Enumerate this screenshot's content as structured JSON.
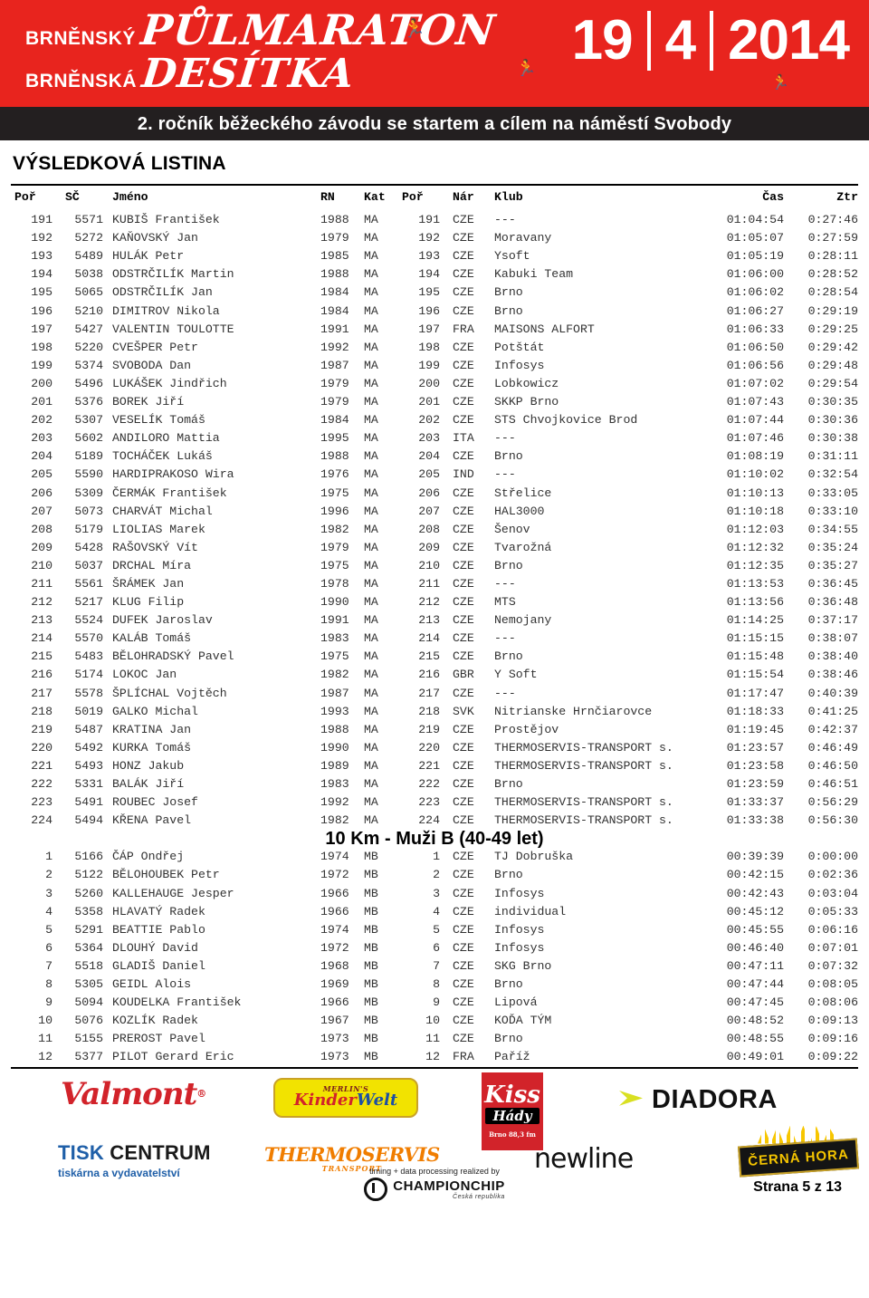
{
  "banner": {
    "brand_line1_small": "BRNĚNSKÝ",
    "brand_line1_script": "PŮLMARATON",
    "brand_line2_small": "BRNĚNSKÁ",
    "brand_line2_script": "DESÍTKA",
    "date_day": "19",
    "date_month": "4",
    "date_year": "2014",
    "subtitle": "2. ročník běžeckého závodu se startem a cílem na náměstí Svobody"
  },
  "document": {
    "title": "VÝSLEDKOVÁ LISTINA",
    "page_label": "Strana 5 z 13"
  },
  "table": {
    "headers": {
      "por": "Poř",
      "sc": "SČ",
      "jmeno": "Jméno",
      "rn": "RN",
      "kat": "Kat",
      "por2": "Poř",
      "nar": "Nár",
      "klub": "Klub",
      "cas": "Čas",
      "ztr": "Ztr"
    }
  },
  "section1": {
    "rows": [
      [
        "191",
        "5571",
        "KUBIŠ František",
        "1988",
        "MA",
        "191",
        "CZE",
        "---",
        "01:04:54",
        "0:27:46"
      ],
      [
        "192",
        "5272",
        "KAŇOVSKÝ Jan",
        "1979",
        "MA",
        "192",
        "CZE",
        "Moravany",
        "01:05:07",
        "0:27:59"
      ],
      [
        "193",
        "5489",
        "HULÁK Petr",
        "1985",
        "MA",
        "193",
        "CZE",
        "Ysoft",
        "01:05:19",
        "0:28:11"
      ],
      [
        "194",
        "5038",
        "ODSTRČILÍK Martin",
        "1988",
        "MA",
        "194",
        "CZE",
        "Kabuki Team",
        "01:06:00",
        "0:28:52"
      ],
      [
        "195",
        "5065",
        "ODSTRČILÍK Jan",
        "1984",
        "MA",
        "195",
        "CZE",
        "Brno",
        "01:06:02",
        "0:28:54"
      ],
      [
        "196",
        "5210",
        "DIMITROV Nikola",
        "1984",
        "MA",
        "196",
        "CZE",
        "Brno",
        "01:06:27",
        "0:29:19"
      ],
      [
        "197",
        "5427",
        "VALENTIN TOULOTTE",
        "1991",
        "MA",
        "197",
        "FRA",
        "MAISONS ALFORT",
        "01:06:33",
        "0:29:25"
      ],
      [
        "198",
        "5220",
        "CVEŠPER Petr",
        "1992",
        "MA",
        "198",
        "CZE",
        "Potštát",
        "01:06:50",
        "0:29:42"
      ],
      [
        "199",
        "5374",
        "SVOBODA Dan",
        "1987",
        "MA",
        "199",
        "CZE",
        "Infosys",
        "01:06:56",
        "0:29:48"
      ],
      [
        "200",
        "5496",
        "LUKÁŠEK Jindřich",
        "1979",
        "MA",
        "200",
        "CZE",
        "Lobkowicz",
        "01:07:02",
        "0:29:54"
      ],
      [
        "201",
        "5376",
        "BOREK Jiří",
        "1979",
        "MA",
        "201",
        "CZE",
        "SKKP Brno",
        "01:07:43",
        "0:30:35"
      ],
      [
        "202",
        "5307",
        "VESELÍK Tomáš",
        "1984",
        "MA",
        "202",
        "CZE",
        "STS Chvojkovice Brod",
        "01:07:44",
        "0:30:36"
      ],
      [
        "203",
        "5602",
        "ANDILORO Mattia",
        "1995",
        "MA",
        "203",
        "ITA",
        "---",
        "01:07:46",
        "0:30:38"
      ],
      [
        "204",
        "5189",
        "TOCHÁČEK Lukáš",
        "1988",
        "MA",
        "204",
        "CZE",
        "Brno",
        "01:08:19",
        "0:31:11"
      ],
      [
        "205",
        "5590",
        "HARDIPRAKOSO Wira",
        "1976",
        "MA",
        "205",
        "IND",
        "---",
        "01:10:02",
        "0:32:54"
      ],
      [
        "206",
        "5309",
        "ČERMÁK František",
        "1975",
        "MA",
        "206",
        "CZE",
        "Střelice",
        "01:10:13",
        "0:33:05"
      ],
      [
        "207",
        "5073",
        "CHARVÁT Michal",
        "1996",
        "MA",
        "207",
        "CZE",
        "HAL3000",
        "01:10:18",
        "0:33:10"
      ],
      [
        "208",
        "5179",
        "LIOLIAS Marek",
        "1982",
        "MA",
        "208",
        "CZE",
        "Šenov",
        "01:12:03",
        "0:34:55"
      ],
      [
        "209",
        "5428",
        "RAŠOVSKÝ Vít",
        "1979",
        "MA",
        "209",
        "CZE",
        "Tvarožná",
        "01:12:32",
        "0:35:24"
      ],
      [
        "210",
        "5037",
        "DRCHAL Míra",
        "1975",
        "MA",
        "210",
        "CZE",
        "Brno",
        "01:12:35",
        "0:35:27"
      ],
      [
        "211",
        "5561",
        "ŠRÁMEK Jan",
        "1978",
        "MA",
        "211",
        "CZE",
        "---",
        "01:13:53",
        "0:36:45"
      ],
      [
        "212",
        "5217",
        "KLUG Filip",
        "1990",
        "MA",
        "212",
        "CZE",
        "MTS",
        "01:13:56",
        "0:36:48"
      ],
      [
        "213",
        "5524",
        "DUFEK Jaroslav",
        "1991",
        "MA",
        "213",
        "CZE",
        "Nemojany",
        "01:14:25",
        "0:37:17"
      ],
      [
        "214",
        "5570",
        "KALÁB Tomáš",
        "1983",
        "MA",
        "214",
        "CZE",
        "---",
        "01:15:15",
        "0:38:07"
      ],
      [
        "215",
        "5483",
        "BĚLOHRADSKÝ Pavel",
        "1975",
        "MA",
        "215",
        "CZE",
        "Brno",
        "01:15:48",
        "0:38:40"
      ],
      [
        "216",
        "5174",
        "LOKOC Jan",
        "1982",
        "MA",
        "216",
        "GBR",
        "Y Soft",
        "01:15:54",
        "0:38:46"
      ],
      [
        "217",
        "5578",
        "ŠPLÍCHAL Vojtěch",
        "1987",
        "MA",
        "217",
        "CZE",
        "---",
        "01:17:47",
        "0:40:39"
      ],
      [
        "218",
        "5019",
        "GALKO Michal",
        "1993",
        "MA",
        "218",
        "SVK",
        "Nitrianske Hrnčiarovce",
        "01:18:33",
        "0:41:25"
      ],
      [
        "219",
        "5487",
        "KRATINA Jan",
        "1988",
        "MA",
        "219",
        "CZE",
        "Prostějov",
        "01:19:45",
        "0:42:37"
      ],
      [
        "220",
        "5492",
        "KURKA Tomáš",
        "1990",
        "MA",
        "220",
        "CZE",
        "THERMOSERVIS-TRANSPORT s.",
        "01:23:57",
        "0:46:49"
      ],
      [
        "221",
        "5493",
        "HONZ Jakub",
        "1989",
        "MA",
        "221",
        "CZE",
        "THERMOSERVIS-TRANSPORT s.",
        "01:23:58",
        "0:46:50"
      ],
      [
        "222",
        "5331",
        "BALÁK Jiří",
        "1983",
        "MA",
        "222",
        "CZE",
        "Brno",
        "01:23:59",
        "0:46:51"
      ],
      [
        "223",
        "5491",
        "ROUBEC Josef",
        "1992",
        "MA",
        "223",
        "CZE",
        "THERMOSERVIS-TRANSPORT s.",
        "01:33:37",
        "0:56:29"
      ],
      [
        "224",
        "5494",
        "KŘENA Pavel",
        "1982",
        "MA",
        "224",
        "CZE",
        "THERMOSERVIS-TRANSPORT s.",
        "01:33:38",
        "0:56:30"
      ]
    ]
  },
  "section2": {
    "heading": "10 Km - Muži B (40-49 let)",
    "rows": [
      [
        "1",
        "5166",
        "ČÁP Ondřej",
        "1974",
        "MB",
        "1",
        "CZE",
        "TJ  Dobruška",
        "00:39:39",
        "0:00:00"
      ],
      [
        "2",
        "5122",
        "BĚLOHOUBEK Petr",
        "1972",
        "MB",
        "2",
        "CZE",
        "Brno",
        "00:42:15",
        "0:02:36"
      ],
      [
        "3",
        "5260",
        "KALLEHAUGE Jesper",
        "1966",
        "MB",
        "3",
        "CZE",
        "Infosys",
        "00:42:43",
        "0:03:04"
      ],
      [
        "4",
        "5358",
        "HLAVATÝ Radek",
        "1966",
        "MB",
        "4",
        "CZE",
        "individual",
        "00:45:12",
        "0:05:33"
      ],
      [
        "5",
        "5291",
        "BEATTIE Pablo",
        "1974",
        "MB",
        "5",
        "CZE",
        "Infosys",
        "00:45:55",
        "0:06:16"
      ],
      [
        "6",
        "5364",
        "DLOUHÝ David",
        "1972",
        "MB",
        "6",
        "CZE",
        "Infosys",
        "00:46:40",
        "0:07:01"
      ],
      [
        "7",
        "5518",
        "GLADIŠ Daniel",
        "1968",
        "MB",
        "7",
        "CZE",
        "SKG Brno",
        "00:47:11",
        "0:07:32"
      ],
      [
        "8",
        "5305",
        "GEIDL Alois",
        "1969",
        "MB",
        "8",
        "CZE",
        "Brno",
        "00:47:44",
        "0:08:05"
      ],
      [
        "9",
        "5094",
        "KOUDELKA František",
        "1966",
        "MB",
        "9",
        "CZE",
        "Lipová",
        "00:47:45",
        "0:08:06"
      ],
      [
        "10",
        "5076",
        "KOZLÍK Radek",
        "1967",
        "MB",
        "10",
        "CZE",
        "KOĎA TÝM",
        "00:48:52",
        "0:09:13"
      ],
      [
        "11",
        "5155",
        "PREROST Pavel",
        "1973",
        "MB",
        "11",
        "CZE",
        "Brno",
        "00:48:55",
        "0:09:16"
      ],
      [
        "12",
        "5377",
        "PILOT Gerard Eric",
        "1973",
        "MB",
        "12",
        "FRA",
        "Paříž",
        "00:49:01",
        "0:09:22"
      ]
    ]
  },
  "sponsors": {
    "valmont": "Valmont",
    "kinder_top": "MERLIN'S",
    "kinder_main_1": "Kinder",
    "kinder_main_2": "Welt",
    "kiss_name": "Kiss",
    "kiss_sub": "Hády",
    "kiss_freq": "Brno 88,3 fm",
    "diadora": "DIADORA",
    "tisk_1": "TISK",
    "tisk_1b": " CENTRUM",
    "tisk_2": "tiskárna a vydavatelství",
    "thermo_1": "THERMOSERVIS",
    "thermo_2": "TRANSPORT",
    "newline": "newline",
    "cerna_hora": "ČERNÁ HORA",
    "timing_note": "timing + data processing realized by",
    "championchip": "CHAMPIONCHIP",
    "championchip_sub": "Česká republika"
  }
}
